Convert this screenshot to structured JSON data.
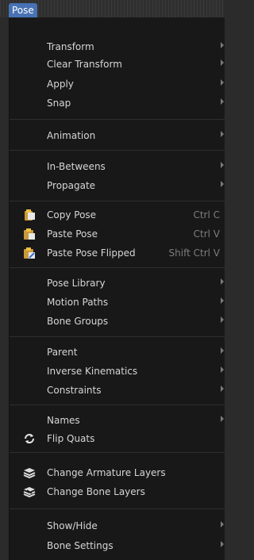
{
  "header": {
    "menu_title": "Pose"
  },
  "menu": {
    "transform": "Transform",
    "clear_transform": "Clear Transform",
    "apply": "Apply",
    "snap": "Snap",
    "animation": "Animation",
    "in_betweens": "In-Betweens",
    "propagate": "Propagate",
    "copy_pose": {
      "label": "Copy Pose",
      "shortcut": "Ctrl C"
    },
    "paste_pose": {
      "label": "Paste Pose",
      "shortcut": "Ctrl V"
    },
    "paste_pose_flipped": {
      "label": "Paste Pose Flipped",
      "shortcut": "Shift Ctrl V"
    },
    "pose_library": "Pose Library",
    "motion_paths": "Motion Paths",
    "bone_groups": "Bone Groups",
    "parent": "Parent",
    "inverse_kinematics": "Inverse Kinematics",
    "constraints": "Constraints",
    "names": "Names",
    "flip_quats": "Flip Quats",
    "change_armature_layers": "Change Armature Layers",
    "change_bone_layers": "Change Bone Layers",
    "show_hide": "Show/Hide",
    "bone_settings": "Bone Settings"
  },
  "icons": {
    "copy_pose": "clipboard-copy-icon",
    "paste_pose": "clipboard-paste-icon",
    "paste_pose_flipped": "clipboard-paste-flipped-icon",
    "flip_quats": "refresh-icon",
    "change_armature_layers": "layers-icon",
    "change_bone_layers": "layers-bone-icon"
  },
  "colors": {
    "accent": "#4772b3",
    "menu_bg": "#181818",
    "text": "#d6d6d6",
    "shortcut": "#7d7d7d"
  }
}
